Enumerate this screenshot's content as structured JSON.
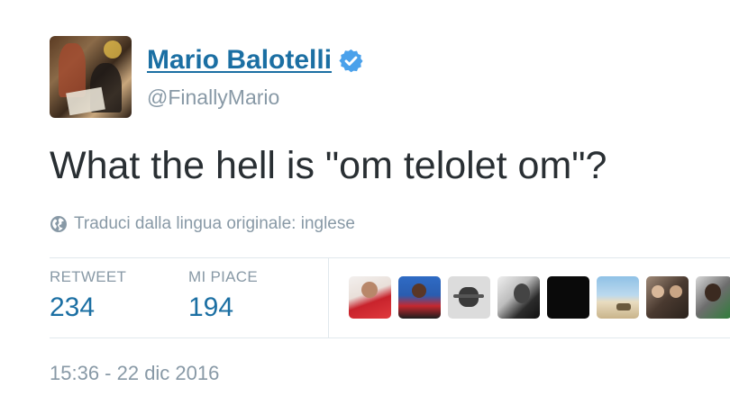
{
  "author": {
    "name": "Mario Balotelli",
    "handle": "@FinallyMario",
    "verified_icon": "verified-badge-icon",
    "accent_color": "#1b6fa3"
  },
  "tweet": {
    "text": "What the hell is \"om telolet om\"?"
  },
  "translate": {
    "icon": "globe-icon",
    "label": "Traduci dalla lingua originale: inglese"
  },
  "stats": {
    "retweet_label": "RETWEET",
    "retweet_count": "234",
    "likes_label": "MI PIACE",
    "likes_count": "194"
  },
  "timestamp": "15:36 - 22 dic 2016"
}
